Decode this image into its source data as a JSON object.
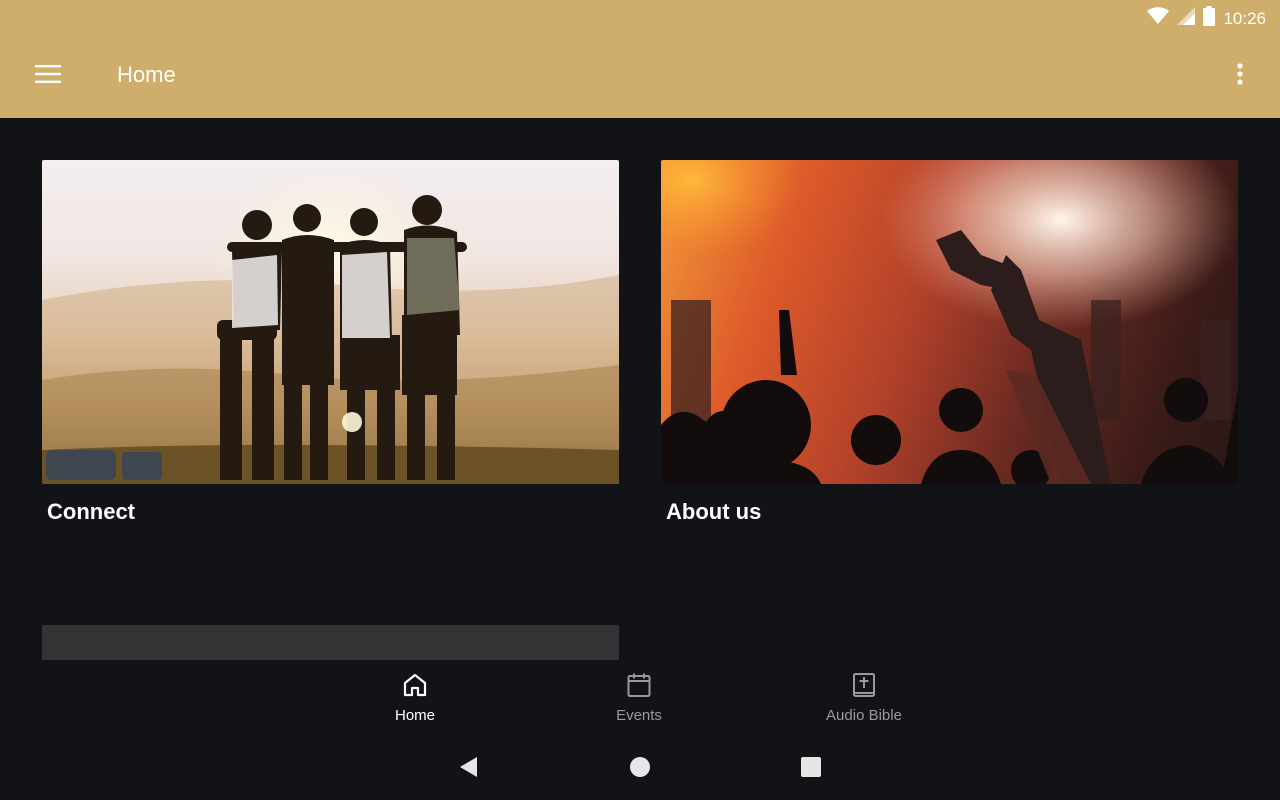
{
  "status_bar": {
    "time": "10:26",
    "icons": [
      "wifi-icon",
      "signal-icon",
      "battery-icon"
    ]
  },
  "app_bar": {
    "title": "Home",
    "left_icon": "menu-icon",
    "right_icon": "more-vert-icon",
    "background_color": "#ceae6a"
  },
  "cards": [
    {
      "title": "Connect",
      "image": "friends-sunset-photo"
    },
    {
      "title": "About us",
      "image": "worship-concert-photo"
    }
  ],
  "bottom_nav": {
    "items": [
      {
        "label": "Home",
        "icon": "home-icon",
        "active": true
      },
      {
        "label": "Events",
        "icon": "calendar-icon",
        "active": false
      },
      {
        "label": "Audio Bible",
        "icon": "bible-icon",
        "active": false
      }
    ]
  },
  "system_nav": [
    "back-icon",
    "home-circle-icon",
    "recents-icon"
  ],
  "colors": {
    "accent": "#ceae6a",
    "background": "#121316",
    "active_nav": "#ffffff",
    "inactive_nav": "#9a9a9c"
  }
}
